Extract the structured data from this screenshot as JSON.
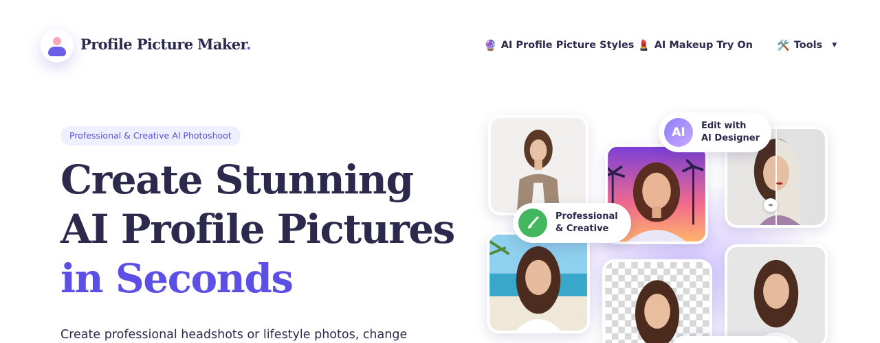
{
  "brand": {
    "name": "Profile Picture Maker",
    "dot": "."
  },
  "nav": [
    {
      "icon": "crystal-ball-icon",
      "emoji": "🔮",
      "label": "AI Profile Picture Styles"
    },
    {
      "icon": "lipstick-icon",
      "emoji": "💄",
      "label": "AI Makeup Try On"
    },
    {
      "icon": "tools-icon",
      "emoji": "🛠️",
      "label": "Tools",
      "caret": "▼"
    }
  ],
  "hero": {
    "pill": "Professional & Creative AI Photoshoot",
    "title_main": "Create Stunning AI Profile Pictures ",
    "title_accent": "in Seconds",
    "description": "Create professional headshots or lifestyle photos, change"
  },
  "collage": {
    "ai_badge": {
      "icon_text": "AI",
      "text": "Edit with\nAI Designer"
    },
    "pro_badge": {
      "icon": "paintbrush-icon",
      "text": "Professional\n& Creative"
    }
  },
  "colors": {
    "accent": "#5b4fe6",
    "text": "#2b2a4c",
    "pill_bg": "#eeefff",
    "green": "#43b760"
  }
}
